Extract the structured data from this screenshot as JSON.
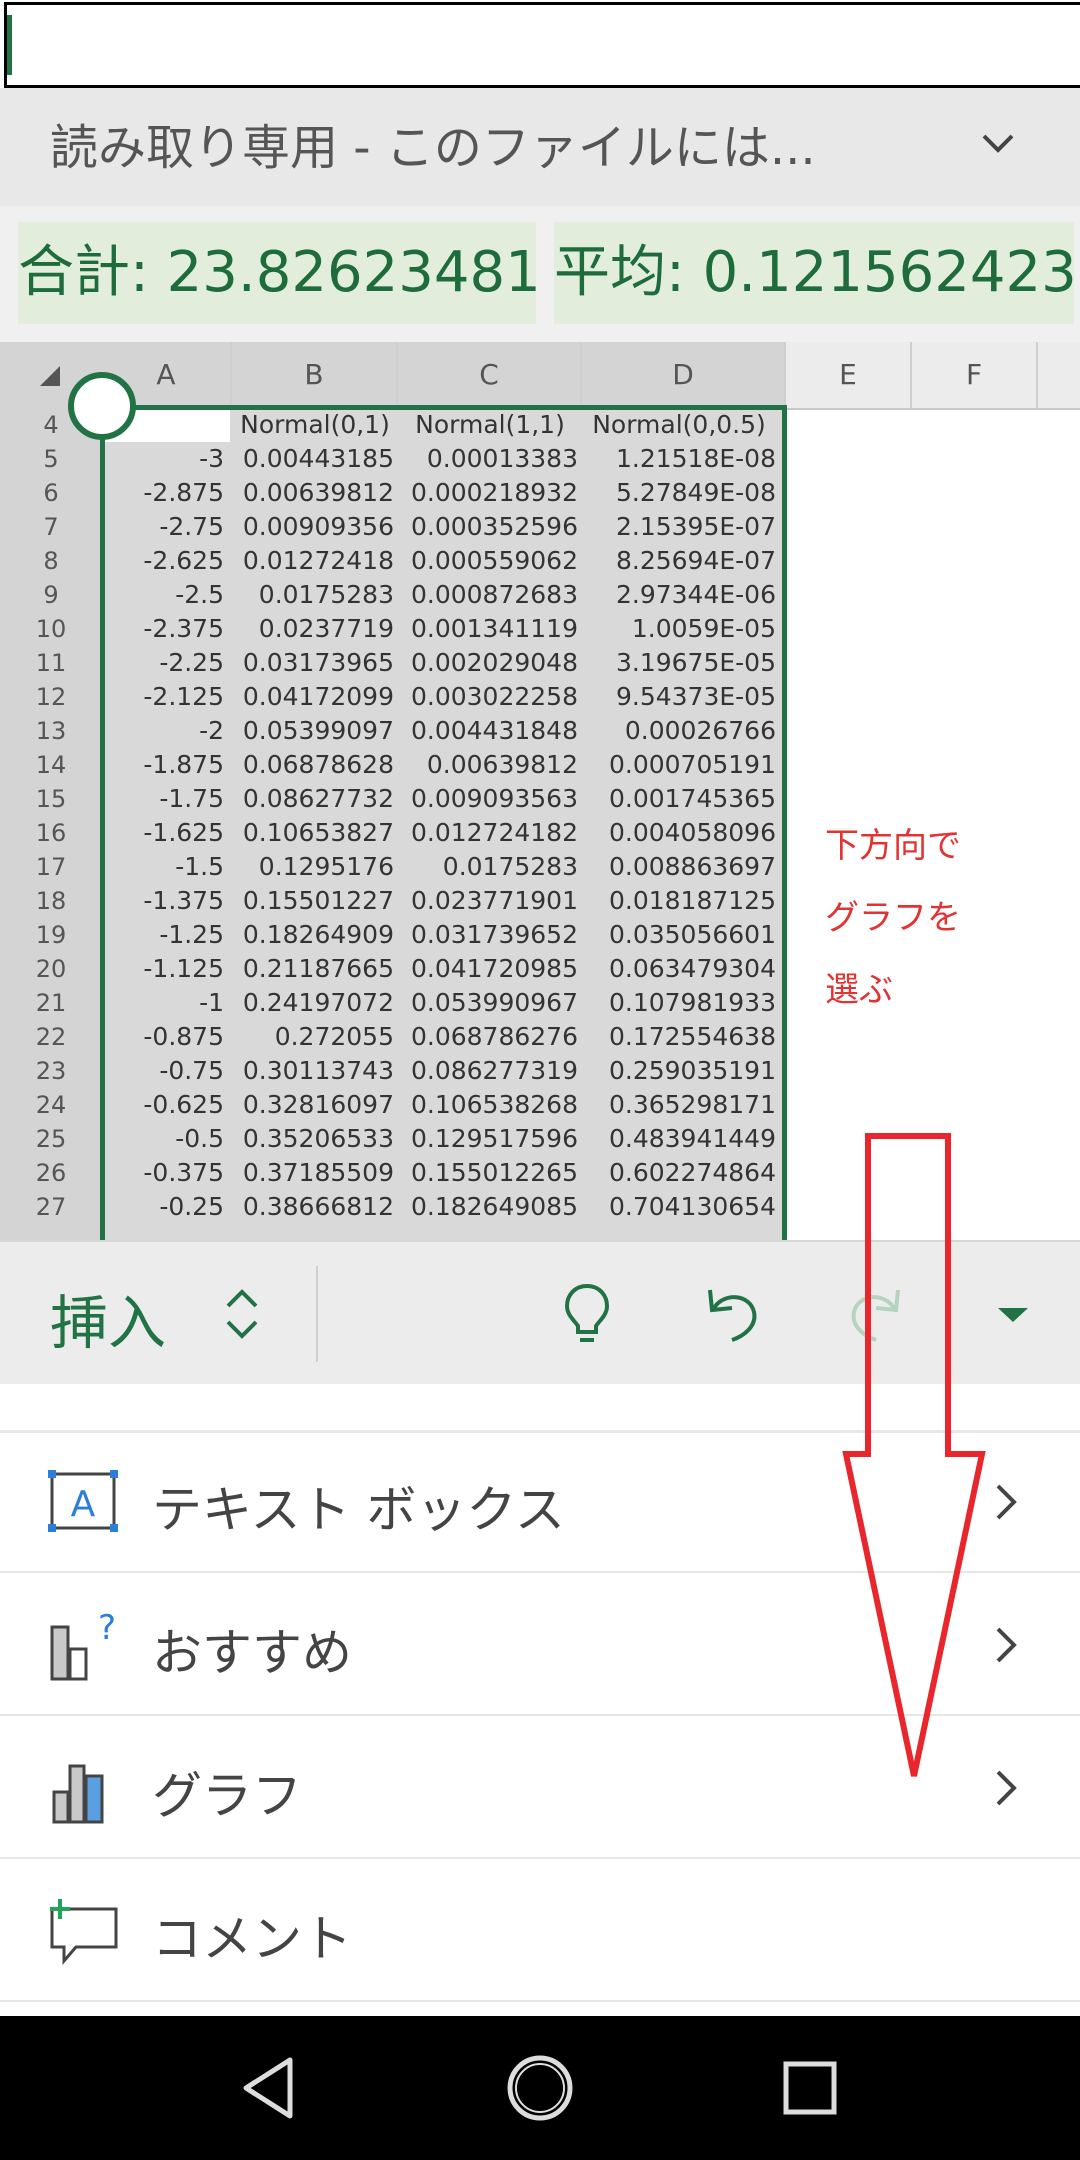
{
  "header": {
    "title": "読み取り専用 - このファイルには..."
  },
  "summary": {
    "sum": "合計: 23.82623481",
    "average": "平均: 0.121562423"
  },
  "grid": {
    "columns": [
      "A",
      "B",
      "C",
      "D",
      "E",
      "F"
    ],
    "header_row": {
      "row": "4",
      "B": "Normal(0,1)",
      "C": "Normal(1,1)",
      "D": "Normal(0,0.5)"
    },
    "rows": [
      {
        "row": "5",
        "A": "-3",
        "B": "0.00443185",
        "C": "0.00013383",
        "D": "1.21518E-08"
      },
      {
        "row": "6",
        "A": "-2.875",
        "B": "0.00639812",
        "C": "0.000218932",
        "D": "5.27849E-08"
      },
      {
        "row": "7",
        "A": "-2.75",
        "B": "0.00909356",
        "C": "0.000352596",
        "D": "2.15395E-07"
      },
      {
        "row": "8",
        "A": "-2.625",
        "B": "0.01272418",
        "C": "0.000559062",
        "D": "8.25694E-07"
      },
      {
        "row": "9",
        "A": "-2.5",
        "B": "0.0175283",
        "C": "0.000872683",
        "D": "2.97344E-06"
      },
      {
        "row": "10",
        "A": "-2.375",
        "B": "0.0237719",
        "C": "0.001341119",
        "D": "1.0059E-05"
      },
      {
        "row": "11",
        "A": "-2.25",
        "B": "0.03173965",
        "C": "0.002029048",
        "D": "3.19675E-05"
      },
      {
        "row": "12",
        "A": "-2.125",
        "B": "0.04172099",
        "C": "0.003022258",
        "D": "9.54373E-05"
      },
      {
        "row": "13",
        "A": "-2",
        "B": "0.05399097",
        "C": "0.004431848",
        "D": "0.00026766"
      },
      {
        "row": "14",
        "A": "-1.875",
        "B": "0.06878628",
        "C": "0.00639812",
        "D": "0.000705191"
      },
      {
        "row": "15",
        "A": "-1.75",
        "B": "0.08627732",
        "C": "0.009093563",
        "D": "0.001745365"
      },
      {
        "row": "16",
        "A": "-1.625",
        "B": "0.10653827",
        "C": "0.012724182",
        "D": "0.004058096"
      },
      {
        "row": "17",
        "A": "-1.5",
        "B": "0.1295176",
        "C": "0.0175283",
        "D": "0.008863697"
      },
      {
        "row": "18",
        "A": "-1.375",
        "B": "0.15501227",
        "C": "0.023771901",
        "D": "0.018187125"
      },
      {
        "row": "19",
        "A": "-1.25",
        "B": "0.18264909",
        "C": "0.031739652",
        "D": "0.035056601"
      },
      {
        "row": "20",
        "A": "-1.125",
        "B": "0.21187665",
        "C": "0.041720985",
        "D": "0.063479304"
      },
      {
        "row": "21",
        "A": "-1",
        "B": "0.24197072",
        "C": "0.053990967",
        "D": "0.107981933"
      },
      {
        "row": "22",
        "A": "-0.875",
        "B": "0.272055",
        "C": "0.068786276",
        "D": "0.172554638"
      },
      {
        "row": "23",
        "A": "-0.75",
        "B": "0.30113743",
        "C": "0.086277319",
        "D": "0.259035191"
      },
      {
        "row": "24",
        "A": "-0.625",
        "B": "0.32816097",
        "C": "0.106538268",
        "D": "0.365298171"
      },
      {
        "row": "25",
        "A": "-0.5",
        "B": "0.35206533",
        "C": "0.129517596",
        "D": "0.483941449"
      },
      {
        "row": "26",
        "A": "-0.375",
        "B": "0.37185509",
        "C": "0.155012265",
        "D": "0.602274864"
      },
      {
        "row": "27",
        "A": "-0.25",
        "B": "0.38666812",
        "C": "0.182649085",
        "D": "0.704130654"
      }
    ]
  },
  "annotation": {
    "lines": [
      "下方向で",
      "グラフを",
      "選ぶ"
    ],
    "color": "#e23333"
  },
  "ribbon": {
    "tab_label": "挿入",
    "icons": [
      "lightbulb-icon",
      "undo-icon",
      "redo-icon",
      "dropdown-caret-icon"
    ]
  },
  "menu": {
    "items": [
      {
        "label": "テキスト ボックス",
        "icon": "text-box-icon"
      },
      {
        "label": "おすすめ",
        "icon": "recommended-chart-icon"
      },
      {
        "label": "グラフ",
        "icon": "chart-icon"
      },
      {
        "label": "コメント",
        "icon": "comment-icon"
      }
    ]
  },
  "colors": {
    "accent_green": "#217346",
    "annotation_red": "#e23333"
  }
}
